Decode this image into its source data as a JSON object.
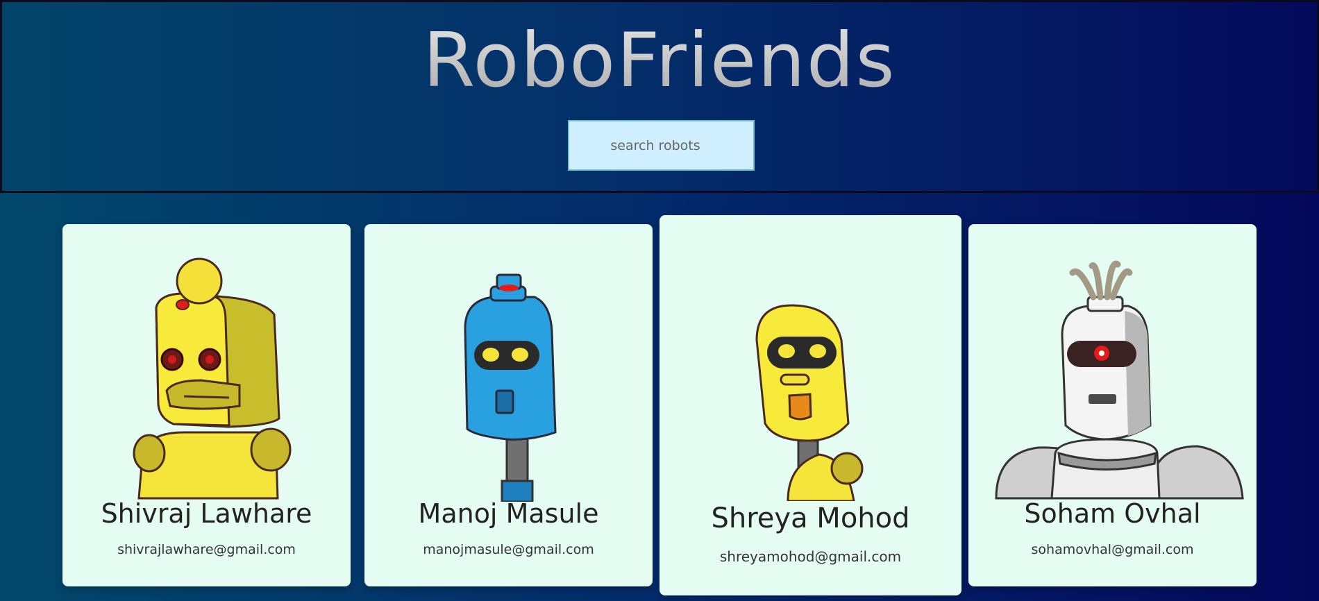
{
  "app": {
    "title": "RoboFriends"
  },
  "search": {
    "placeholder": "search robots"
  },
  "robots": [
    {
      "name": "Shivraj Lawhare",
      "email": "shivrajlawhare@gmail.com",
      "robot_icon": "yellow-robot-icon"
    },
    {
      "name": "Manoj Masule",
      "email": "manojmasule@gmail.com",
      "robot_icon": "blue-robot-icon"
    },
    {
      "name": "Shreya Mohod",
      "email": "shreyamohod@gmail.com",
      "robot_icon": "yellow-robot-icon"
    },
    {
      "name": "Soham Ovhal",
      "email": "sohamovhal@gmail.com",
      "robot_icon": "white-robot-icon"
    }
  ],
  "colors": {
    "background_start": "#02486b",
    "background_end": "#04085c",
    "card": "#e5fcf3",
    "search_field": "#cfeefe"
  }
}
